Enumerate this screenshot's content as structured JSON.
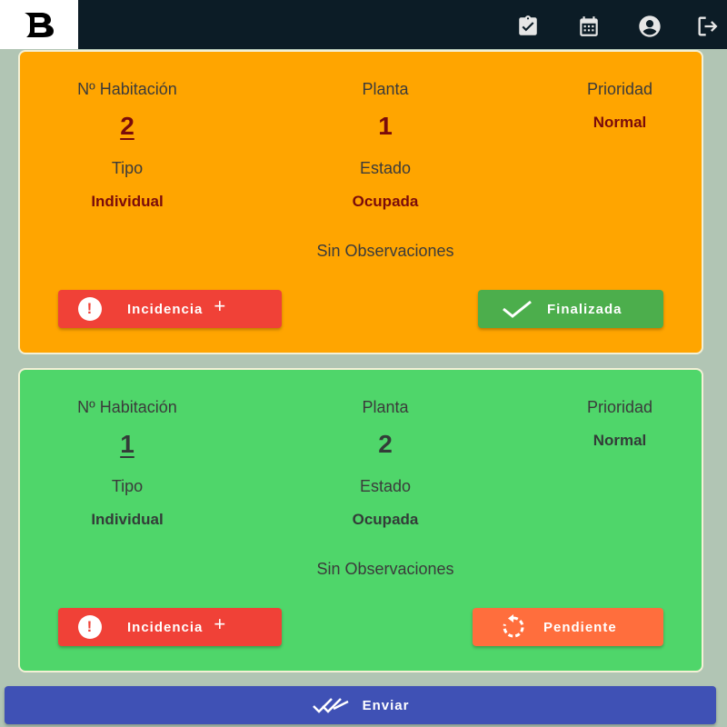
{
  "header": {
    "icons": [
      "clipboard-check-icon",
      "calendar-icon",
      "account-icon",
      "logout-icon"
    ]
  },
  "labels": {
    "room": "Nº Habitación",
    "floor": "Planta",
    "priority": "Prioridad",
    "type": "Tipo",
    "state": "Estado"
  },
  "cards": [
    {
      "room": "2",
      "floor": "1",
      "priority": "Normal",
      "type": "Individual",
      "state": "Ocupada",
      "observations": "Sin Observaciones",
      "incident_label": "Incidencia",
      "status_label": "Finalizada",
      "color": "#ffa500"
    },
    {
      "room": "1",
      "floor": "2",
      "priority": "Normal",
      "type": "Individual",
      "state": "Ocupada",
      "observations": "Sin Observaciones",
      "incident_label": "Incidencia",
      "status_label": "Pendiente",
      "color": "#4fd66a"
    }
  ],
  "submit_label": "Enviar",
  "colors": {
    "topbar": "#0c1c26",
    "incident": "#f04137",
    "finished": "#4cae4c",
    "pending": "#ff6e3d",
    "submit": "#3f51b5"
  }
}
